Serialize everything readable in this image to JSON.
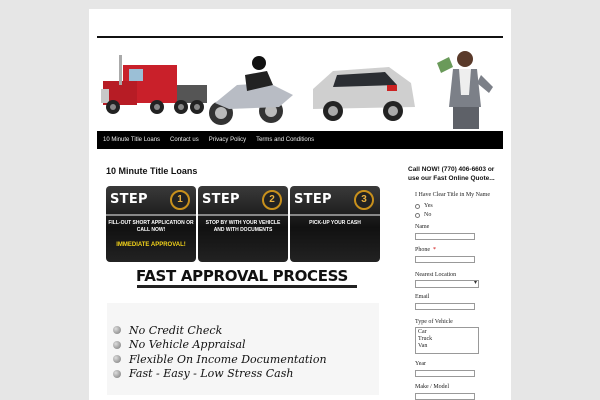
{
  "nav": {
    "items": [
      "10 Minute Title Loans",
      "Contact us",
      "Privacy Policy",
      "Terms and Conditions"
    ]
  },
  "post": {
    "title": "10 Minute Title Loans"
  },
  "steps": [
    {
      "word": "STEP",
      "number": "1",
      "desc": "FILL-OUT SHORT APPLICATION OR CALL NOW!",
      "highlight": "IMMEDIATE APPROVAL!"
    },
    {
      "word": "STEP",
      "number": "2",
      "desc": "STOP BY WITH YOUR VEHICLE AND WITH DOCUMENTS",
      "highlight": ""
    },
    {
      "word": "STEP",
      "number": "3",
      "desc": "PICK-UP YOUR CASH",
      "highlight": ""
    }
  ],
  "approval": {
    "heading": "FAST APPROVAL PROCESS",
    "features": [
      "No Credit Check",
      "No Vehicle Appraisal",
      "Flexible On Income Documentation",
      "Fast - Easy - Low Stress Cash"
    ]
  },
  "sidebar": {
    "heading": "Call NOW! (770) 406-6603 or use our Fast Online Quote..."
  },
  "form": {
    "clear_title_label": "I Have Clear Title in My Name",
    "yes_label": "Yes",
    "no_label": "No",
    "name_label": "Name",
    "phone_label": "Phone",
    "required_mark": "*",
    "location_label": "Nearest Location",
    "email_label": "Email",
    "vehicle_type_label": "Type of Vehicle",
    "vehicle_types": [
      "Car",
      "Truck",
      "Van"
    ],
    "year_label": "Year",
    "make_model_label": "Make / Model"
  },
  "colors": {
    "nav_bg": "#000000",
    "step_accent": "#c8901c",
    "highlight": "#f2d21a"
  }
}
